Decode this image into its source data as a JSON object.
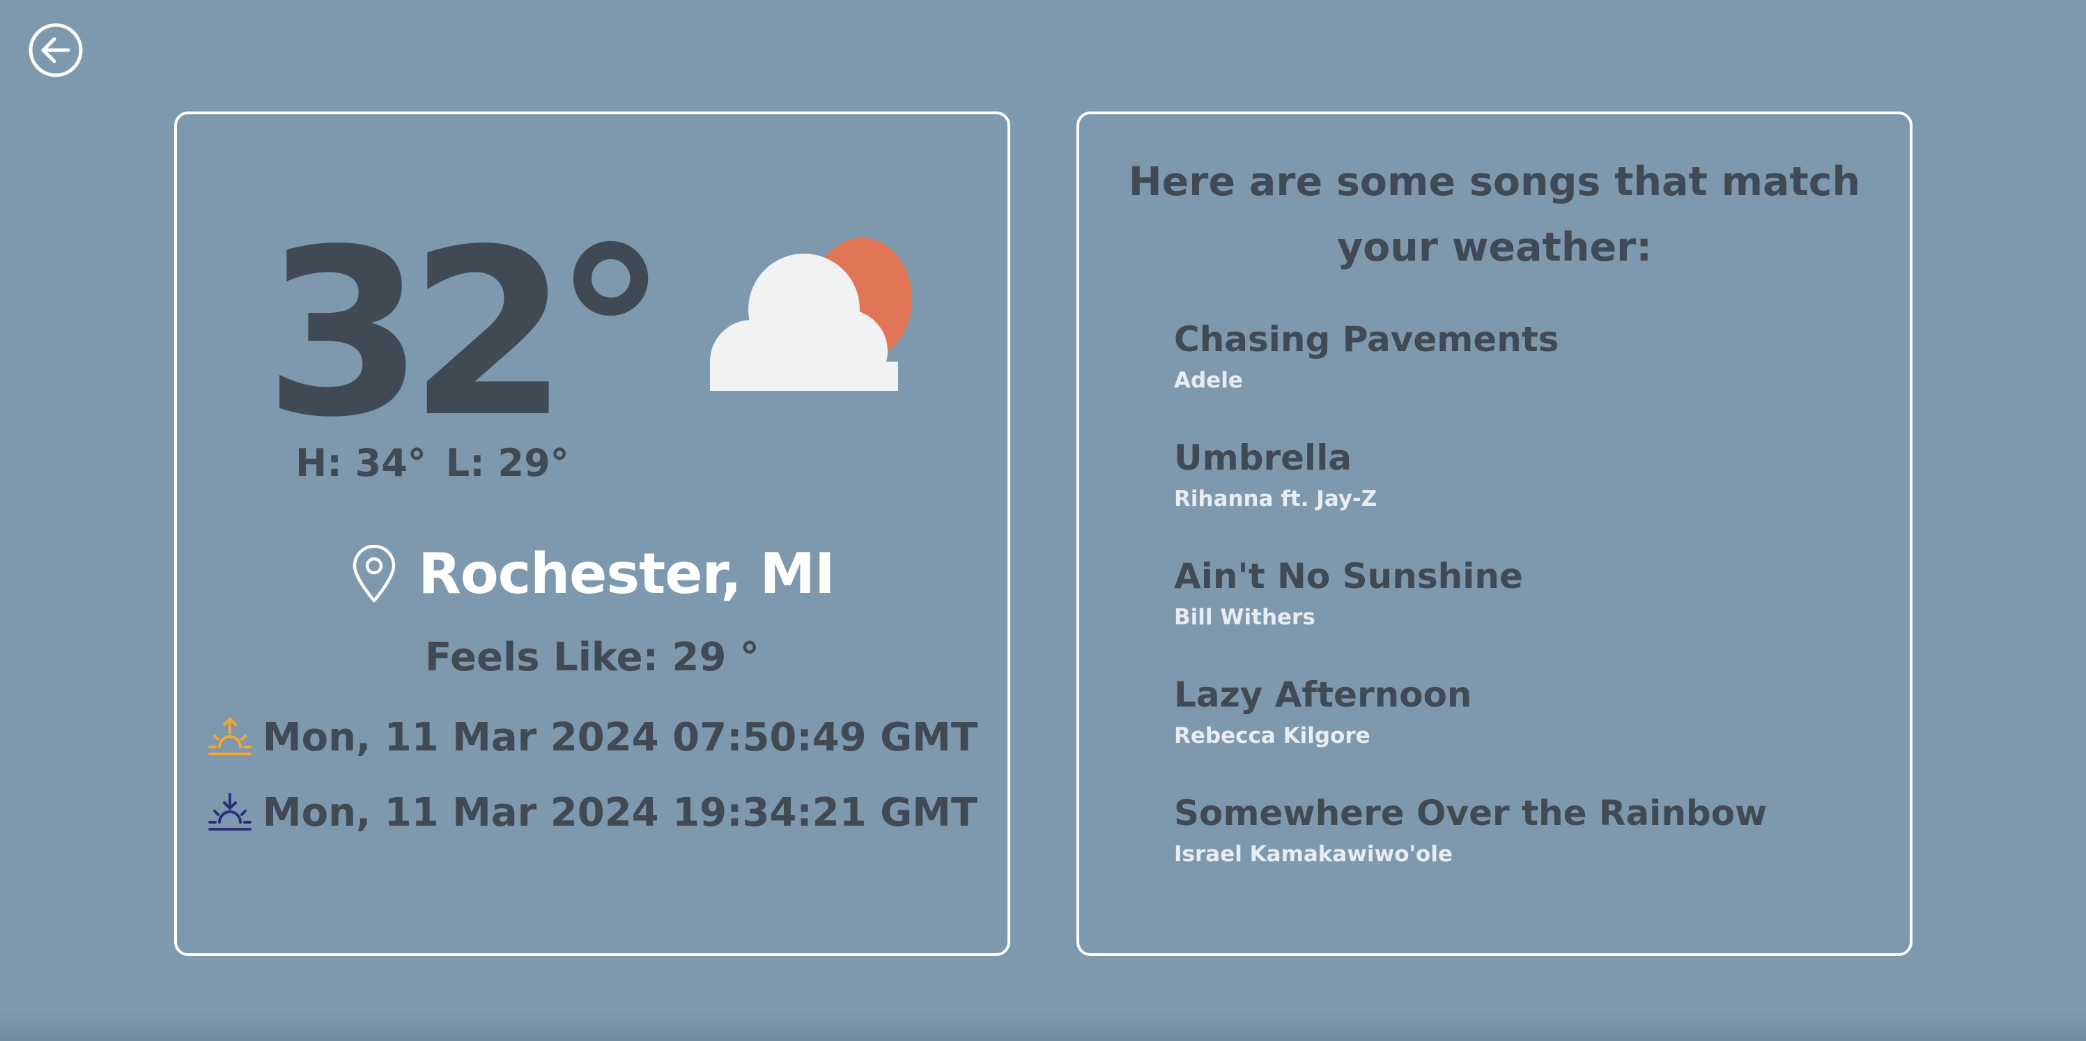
{
  "weather": {
    "temperature": "32°",
    "condition_icon": "partly-cloudy-icon",
    "high": "H: 34°",
    "low": "L: 29°",
    "location": "Rochester, MI",
    "feels_like": "Feels Like: 29 °",
    "sunrise": "Mon, 11 Mar 2024 07:50:49 GMT",
    "sunset": "Mon, 11 Mar 2024 19:34:21 GMT"
  },
  "songs": {
    "heading": "Here are some songs that match your weather:",
    "items": [
      {
        "title": "Chasing Pavements",
        "artist": "Adele"
      },
      {
        "title": "Umbrella",
        "artist": "Rihanna ft. Jay-Z"
      },
      {
        "title": "Ain't No Sunshine",
        "artist": "Bill Withers"
      },
      {
        "title": "Lazy Afternoon",
        "artist": "Rebecca Kilgore"
      },
      {
        "title": "Somewhere Over the Rainbow",
        "artist": "Israel Kamakawiwo'ole"
      }
    ]
  },
  "colors": {
    "background": "#7e98ae",
    "text_dark": "#3f4a55",
    "sun": "#e07555",
    "sunrise_icon": "#f0a830",
    "sunset_icon": "#2a2f7a"
  },
  "icons": {
    "back": "back-arrow-icon",
    "pin": "location-pin-icon",
    "sunrise": "sunrise-icon",
    "sunset": "sunset-icon"
  }
}
